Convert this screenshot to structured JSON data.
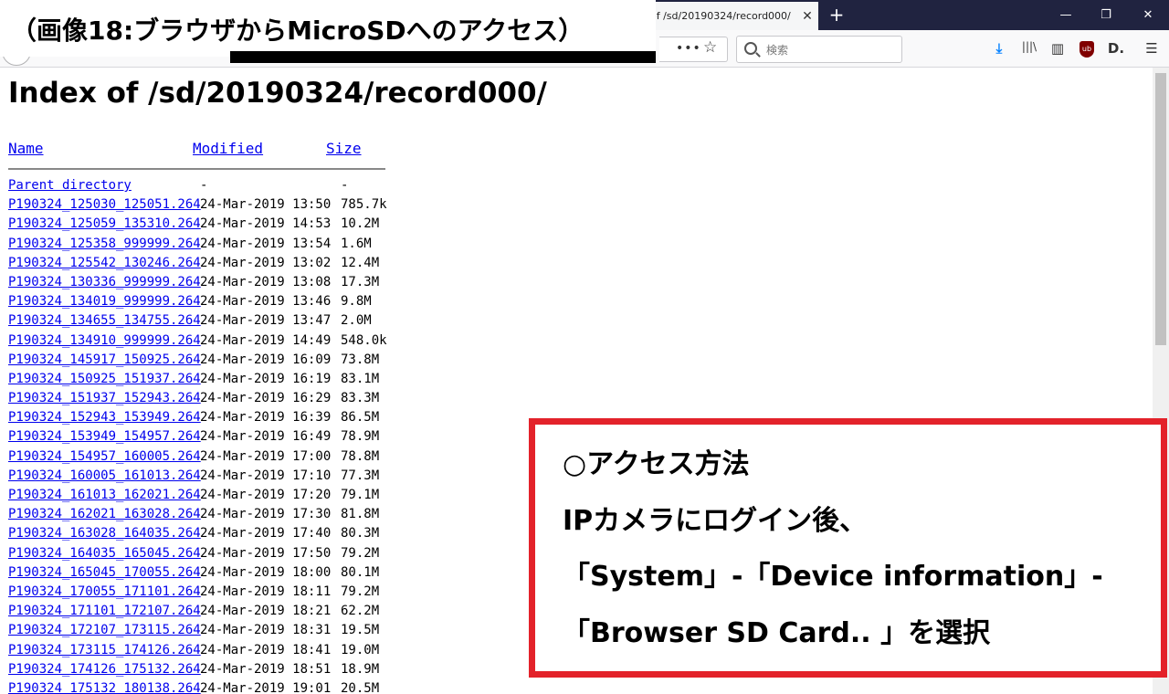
{
  "caption": "（画像18:ブラウザからMicroSDへのアクセス）",
  "browser": {
    "tab_title": "of /sd/20190324/record000/",
    "tab_close": "✕",
    "new_tab": "+",
    "window_min": "—",
    "window_restore": "❐",
    "window_close": "✕",
    "url_more": "•••",
    "bookmark_star": "☆",
    "search_placeholder": "検索",
    "toolbar_icons": {
      "download": "⤓",
      "library": "|||\\",
      "sidebar": "▥",
      "ublock": "ub",
      "dashlane": "D.",
      "menu": "☰"
    }
  },
  "page": {
    "heading": "Index of /sd/20190324/record000/",
    "columns": {
      "name": "Name",
      "modified": "Modified",
      "size": "Size"
    },
    "parent": {
      "name": "Parent directory",
      "modified": "-",
      "size": "-"
    },
    "files": [
      {
        "name": "P190324_125030_125051.264",
        "modified": "24-Mar-2019 13:50",
        "size": "785.7k"
      },
      {
        "name": "P190324_125059_135310.264",
        "modified": "24-Mar-2019 14:53",
        "size": "10.2M"
      },
      {
        "name": "P190324_125358_999999.264",
        "modified": "24-Mar-2019 13:54",
        "size": "1.6M"
      },
      {
        "name": "P190324_125542_130246.264",
        "modified": "24-Mar-2019 13:02",
        "size": "12.4M"
      },
      {
        "name": "P190324_130336_999999.264",
        "modified": "24-Mar-2019 13:08",
        "size": "17.3M"
      },
      {
        "name": "P190324_134019_999999.264",
        "modified": "24-Mar-2019 13:46",
        "size": "9.8M"
      },
      {
        "name": "P190324_134655_134755.264",
        "modified": "24-Mar-2019 13:47",
        "size": "2.0M"
      },
      {
        "name": "P190324_134910_999999.264",
        "modified": "24-Mar-2019 14:49",
        "size": "548.0k"
      },
      {
        "name": "P190324_145917_150925.264",
        "modified": "24-Mar-2019 16:09",
        "size": "73.8M"
      },
      {
        "name": "P190324_150925_151937.264",
        "modified": "24-Mar-2019 16:19",
        "size": "83.1M"
      },
      {
        "name": "P190324_151937_152943.264",
        "modified": "24-Mar-2019 16:29",
        "size": "83.3M"
      },
      {
        "name": "P190324_152943_153949.264",
        "modified": "24-Mar-2019 16:39",
        "size": "86.5M"
      },
      {
        "name": "P190324_153949_154957.264",
        "modified": "24-Mar-2019 16:49",
        "size": "78.9M"
      },
      {
        "name": "P190324_154957_160005.264",
        "modified": "24-Mar-2019 17:00",
        "size": "78.8M"
      },
      {
        "name": "P190324_160005_161013.264",
        "modified": "24-Mar-2019 17:10",
        "size": "77.3M"
      },
      {
        "name": "P190324_161013_162021.264",
        "modified": "24-Mar-2019 17:20",
        "size": "79.1M"
      },
      {
        "name": "P190324_162021_163028.264",
        "modified": "24-Mar-2019 17:30",
        "size": "81.8M"
      },
      {
        "name": "P190324_163028_164035.264",
        "modified": "24-Mar-2019 17:40",
        "size": "80.3M"
      },
      {
        "name": "P190324_164035_165045.264",
        "modified": "24-Mar-2019 17:50",
        "size": "79.2M"
      },
      {
        "name": "P190324_165045_170055.264",
        "modified": "24-Mar-2019 18:00",
        "size": "80.1M"
      },
      {
        "name": "P190324_170055_171101.264",
        "modified": "24-Mar-2019 18:11",
        "size": "79.2M"
      },
      {
        "name": "P190324_171101_172107.264",
        "modified": "24-Mar-2019 18:21",
        "size": "62.2M"
      },
      {
        "name": "P190324_172107_173115.264",
        "modified": "24-Mar-2019 18:31",
        "size": "19.5M"
      },
      {
        "name": "P190324_173115_174126.264",
        "modified": "24-Mar-2019 18:41",
        "size": "19.0M"
      },
      {
        "name": "P190324_174126_175132.264",
        "modified": "24-Mar-2019 18:51",
        "size": "18.9M"
      },
      {
        "name": "P190324_175132_180138.264",
        "modified": "24-Mar-2019 19:01",
        "size": "20.5M"
      }
    ]
  },
  "note": {
    "lines": [
      "○アクセス方法",
      "IPカメラにログイン後、",
      "「System」-「Device information」-",
      "「Browser SD Card.. 」を選択"
    ],
    "border_color": "#e3222a"
  }
}
